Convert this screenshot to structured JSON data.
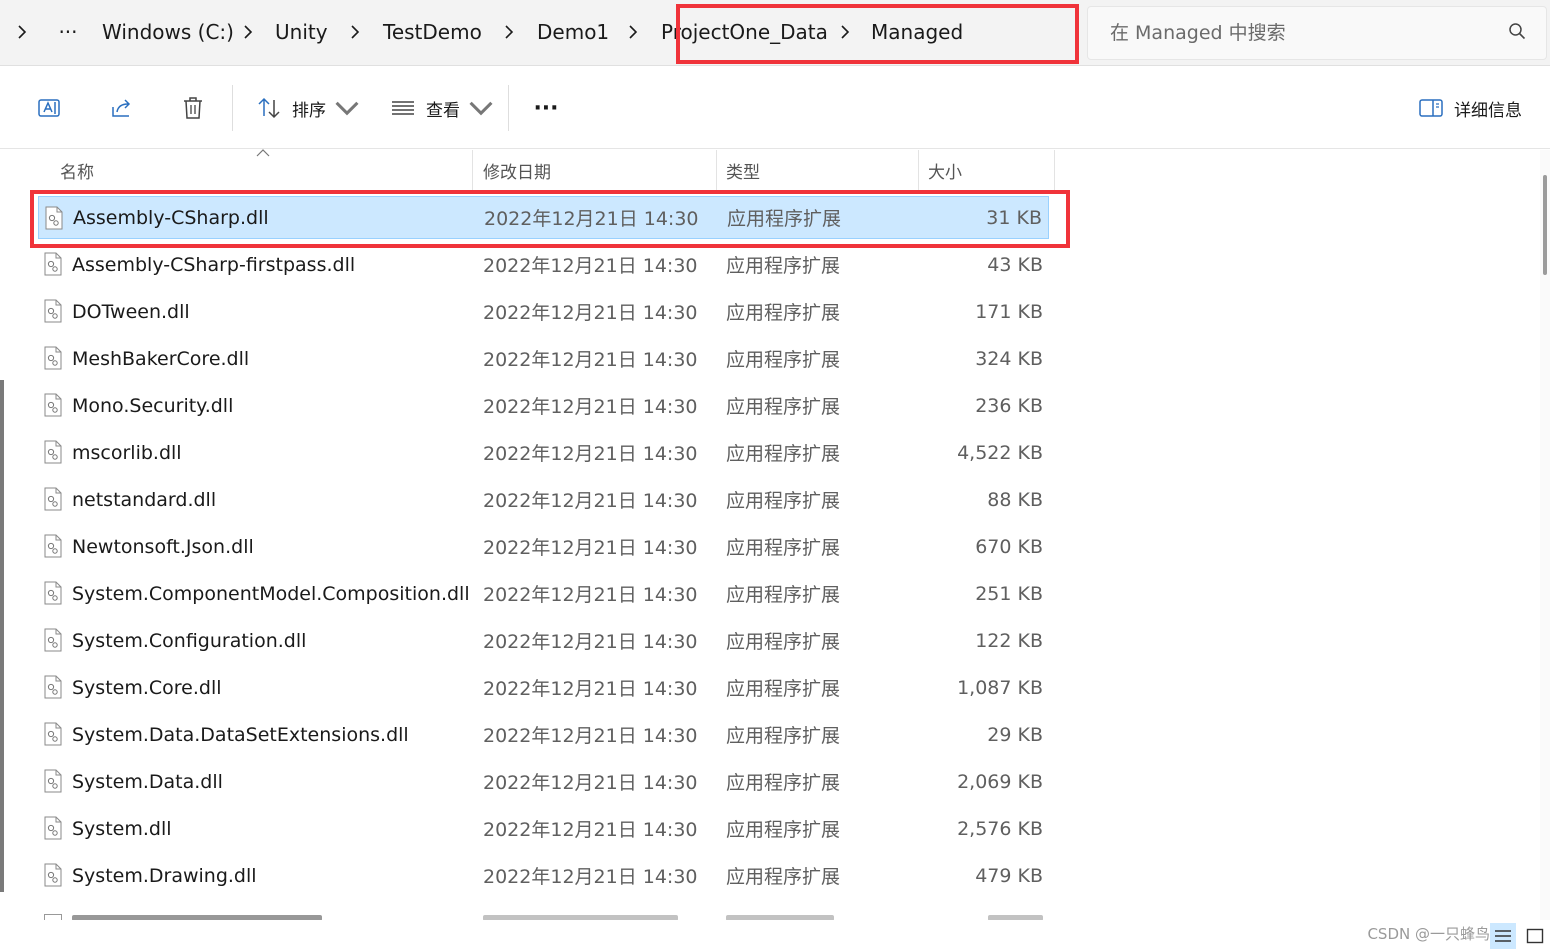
{
  "address_bar": {
    "more": "···",
    "breadcrumbs": [
      "Windows (C:)",
      "Unity",
      "TestDemo",
      "Demo1",
      "ProjectOne_Data",
      "Managed"
    ]
  },
  "search": {
    "placeholder": "在 Managed 中搜索"
  },
  "toolbar": {
    "sort_label": "排序",
    "view_label": "查看",
    "more_label": "···",
    "details_label": "详细信息"
  },
  "columns": {
    "name": "名称",
    "date": "修改日期",
    "type": "类型",
    "size": "大小"
  },
  "files": [
    {
      "name": "Assembly-CSharp.dll",
      "date": "2022年12月21日 14:30",
      "type": "应用程序扩展",
      "size": "31 KB",
      "selected": true
    },
    {
      "name": "Assembly-CSharp-firstpass.dll",
      "date": "2022年12月21日 14:30",
      "type": "应用程序扩展",
      "size": "43 KB"
    },
    {
      "name": "DOTween.dll",
      "date": "2022年12月21日 14:30",
      "type": "应用程序扩展",
      "size": "171 KB"
    },
    {
      "name": "MeshBakerCore.dll",
      "date": "2022年12月21日 14:30",
      "type": "应用程序扩展",
      "size": "324 KB"
    },
    {
      "name": "Mono.Security.dll",
      "date": "2022年12月21日 14:30",
      "type": "应用程序扩展",
      "size": "236 KB"
    },
    {
      "name": "mscorlib.dll",
      "date": "2022年12月21日 14:30",
      "type": "应用程序扩展",
      "size": "4,522 KB"
    },
    {
      "name": "netstandard.dll",
      "date": "2022年12月21日 14:30",
      "type": "应用程序扩展",
      "size": "88 KB"
    },
    {
      "name": "Newtonsoft.Json.dll",
      "date": "2022年12月21日 14:30",
      "type": "应用程序扩展",
      "size": "670 KB"
    },
    {
      "name": "System.ComponentModel.Composition.dll",
      "date": "2022年12月21日 14:30",
      "type": "应用程序扩展",
      "size": "251 KB"
    },
    {
      "name": "System.Configuration.dll",
      "date": "2022年12月21日 14:30",
      "type": "应用程序扩展",
      "size": "122 KB"
    },
    {
      "name": "System.Core.dll",
      "date": "2022年12月21日 14:30",
      "type": "应用程序扩展",
      "size": "1,087 KB"
    },
    {
      "name": "System.Data.DataSetExtensions.dll",
      "date": "2022年12月21日 14:30",
      "type": "应用程序扩展",
      "size": "29 KB"
    },
    {
      "name": "System.Data.dll",
      "date": "2022年12月21日 14:30",
      "type": "应用程序扩展",
      "size": "2,069 KB"
    },
    {
      "name": "System.dll",
      "date": "2022年12月21日 14:30",
      "type": "应用程序扩展",
      "size": "2,576 KB"
    },
    {
      "name": "System.Drawing.dll",
      "date": "2022年12月21日 14:30",
      "type": "应用程序扩展",
      "size": "479 KB"
    }
  ],
  "watermark": "CSDN @一只蜂鸟",
  "colors": {
    "highlight": "#f0333a",
    "selection": "#cce8ff",
    "selection_border": "#99d1ff"
  },
  "icons": [
    "chevron-right-icon",
    "search-icon",
    "rename-icon",
    "share-icon",
    "delete-icon",
    "sort-icon",
    "view-icon",
    "details-pane-icon",
    "dll-file-icon"
  ]
}
